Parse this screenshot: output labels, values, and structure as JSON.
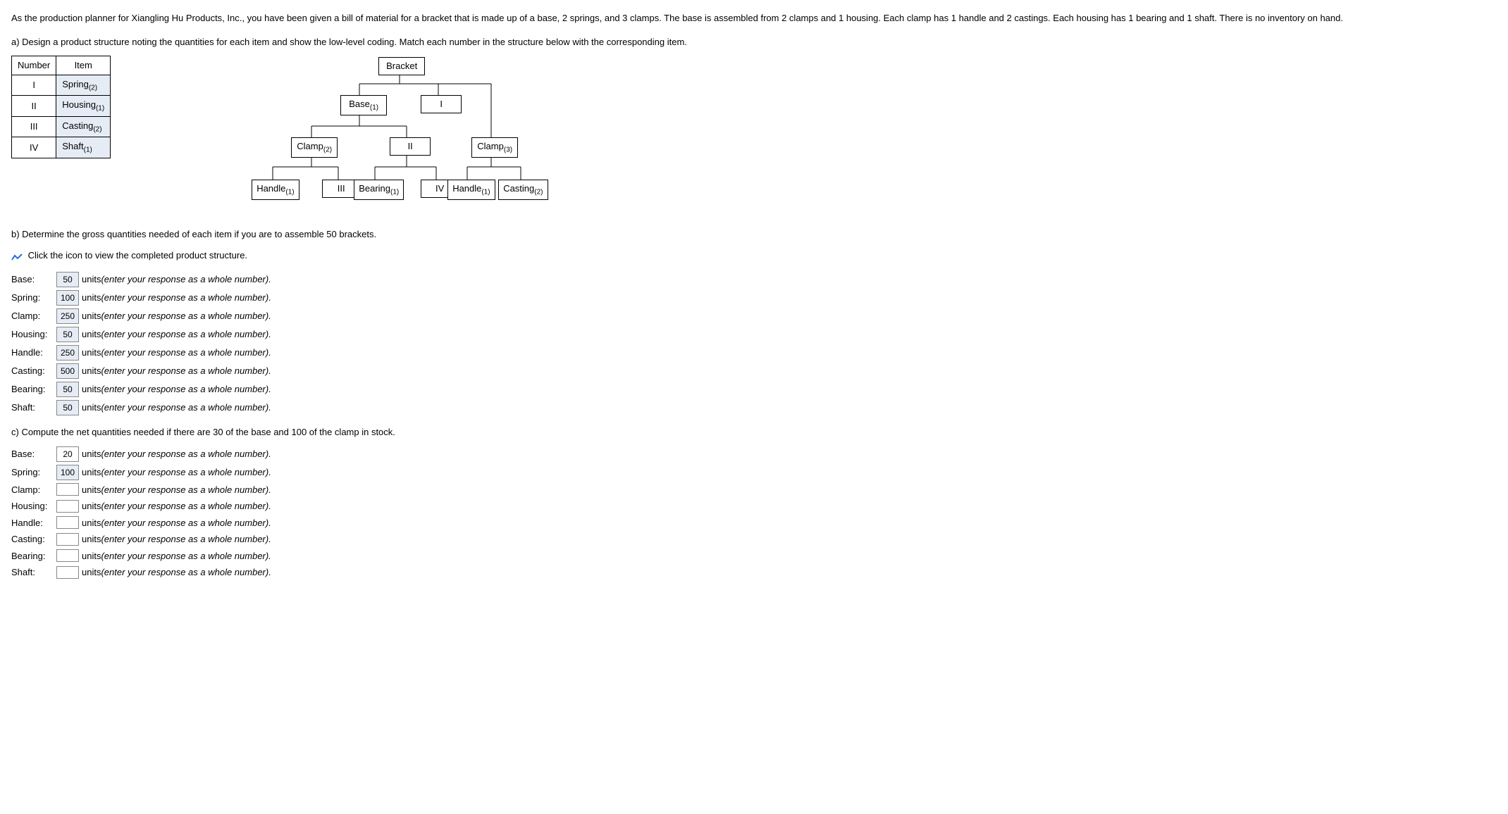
{
  "intro_text": "As the production planner for Xiangling Hu Products, Inc., you have been given a bill of material for a bracket that is made up of a base, 2 springs, and 3 clamps. The base is assembled from 2 clamps and 1 housing. Each clamp has 1 handle and 2 castings. Each housing has 1 bearing and 1 shaft. There is no inventory on hand.",
  "part_a_text": "a) Design a product structure noting the quantities for each item and show the low-level coding. Match each number in the structure below with the corresponding item.",
  "map_header_num": "Number",
  "map_header_item": "Item",
  "map_rows": [
    {
      "num": "I",
      "item_name": "Spring",
      "item_sub": "(2)"
    },
    {
      "num": "II",
      "item_name": "Housing",
      "item_sub": "(1)"
    },
    {
      "num": "III",
      "item_name": "Casting",
      "item_sub": "(2)"
    },
    {
      "num": "IV",
      "item_name": "Shaft",
      "item_sub": "(1)"
    }
  ],
  "tree": {
    "bracket": "Bracket",
    "base": "Base",
    "base_sub": "(1)",
    "I": "I",
    "clamp2": "Clamp",
    "clamp2_sub": "(2)",
    "II": "II",
    "clamp3": "Clamp",
    "clamp3_sub": "(3)",
    "handle1a": "Handle",
    "handle1a_sub": "(1)",
    "III": "III",
    "bearing": "Bearing",
    "bearing_sub": "(1)",
    "IV": "IV",
    "handle1b": "Handle",
    "handle1b_sub": "(1)",
    "casting2": "Casting",
    "casting2_sub": "(2)"
  },
  "part_b_text": "b) Determine the gross quantities needed of each item if you are to assemble 50 brackets.",
  "icon_text": "Click the icon to view the completed product structure.",
  "units_label": "units",
  "hint_text": "(enter your response as a whole number).",
  "rows_b": [
    {
      "label": "Base:",
      "value": "50"
    },
    {
      "label": "Spring:",
      "value": "100"
    },
    {
      "label": "Clamp:",
      "value": "250"
    },
    {
      "label": "Housing:",
      "value": "50"
    },
    {
      "label": "Handle:",
      "value": "250"
    },
    {
      "label": "Casting:",
      "value": "500"
    },
    {
      "label": "Bearing:",
      "value": "50"
    },
    {
      "label": "Shaft:",
      "value": "50"
    }
  ],
  "part_c_text": "c) Compute the net quantities needed if there are 30 of the base and 100 of the clamp in stock.",
  "rows_c": [
    {
      "label": "Base:",
      "value": "20",
      "boxed": true
    },
    {
      "label": "Spring:",
      "value": "100",
      "boxed": false
    },
    {
      "label": "Clamp:",
      "value": "",
      "boxed": true
    },
    {
      "label": "Housing:",
      "value": "",
      "boxed": true
    },
    {
      "label": "Handle:",
      "value": "",
      "boxed": true
    },
    {
      "label": "Casting:",
      "value": "",
      "boxed": true
    },
    {
      "label": "Bearing:",
      "value": "",
      "boxed": true
    },
    {
      "label": "Shaft:",
      "value": "",
      "boxed": true
    }
  ]
}
